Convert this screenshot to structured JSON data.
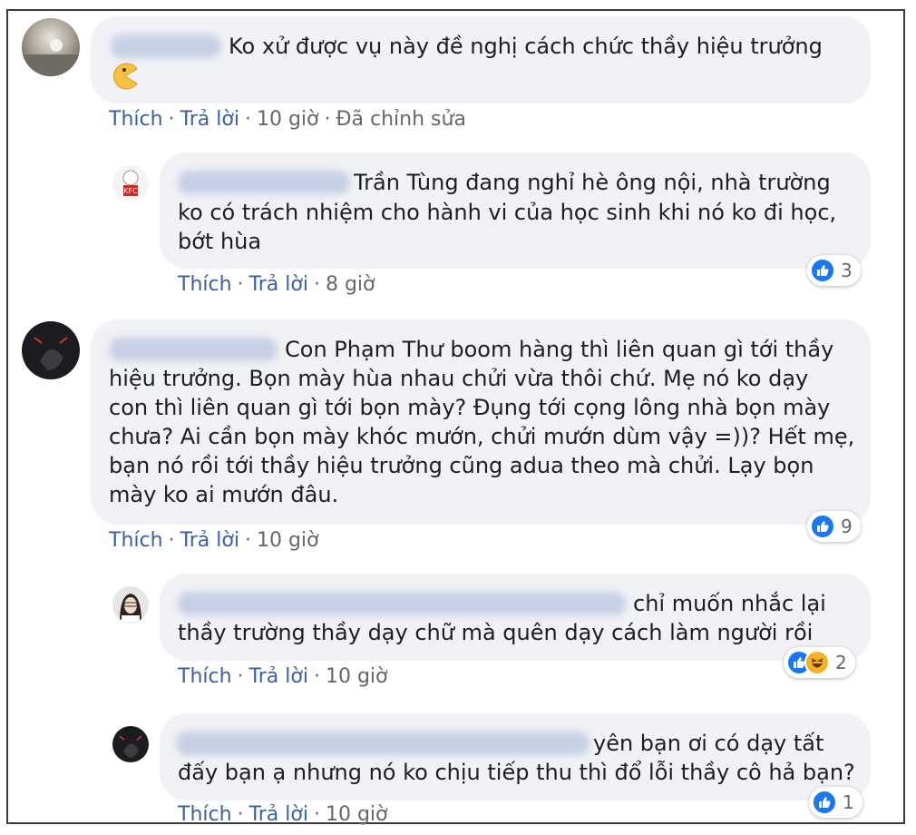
{
  "comments": [
    {
      "author": "",
      "text_lines": [
        "Ko xử được vụ này đề nghị cách chức thầy hiệu trưởng"
      ],
      "actions": {
        "like": "Thích",
        "reply": "Trả lời",
        "time": "10 giờ",
        "edited": "Đã chỉnh sửa"
      }
    },
    {
      "author": "",
      "text_lines": [
        "Trần Tùng đang nghỉ hè ông nội, nhà trường",
        "ko có trách nhiệm cho hành vi của học sinh khi nó ko đi học,",
        "bớt hùa"
      ],
      "actions": {
        "like": "Thích",
        "reply": "Trả lời",
        "time": "8 giờ"
      },
      "reaction_count": "3"
    },
    {
      "author": "",
      "text_lines": [
        "Con Phạm Thư boom hàng thì liên quan gì tới thầy",
        "hiệu trưởng. Bọn mày hùa nhau chửi vừa thôi chứ. Mẹ nó ko dạy",
        "con thì liên quan gì tới bọn mày? Đụng tới cọng lông nhà bọn mày",
        "chưa? Ai cần bọn mày khóc mướn, chửi mướn dùm vậy =))? Hết mẹ,",
        "bạn nó rồi tới thầy hiệu trưởng cũng adua theo mà chửi. Lạy bọn",
        "mày ko ai mướn đâu."
      ],
      "actions": {
        "like": "Thích",
        "reply": "Trả lời",
        "time": "10 giờ"
      },
      "reaction_count": "9"
    },
    {
      "author": "",
      "text_lines": [
        "chỉ muốn nhắc lại",
        "thầy trường thầy dạy chữ mà quên dạy cách làm người rồi"
      ],
      "actions": {
        "like": "Thích",
        "reply": "Trả lời",
        "time": "10 giờ"
      },
      "reaction_count": "2"
    },
    {
      "author": "",
      "text_lines": [
        "yên bạn ơi có dạy tất",
        "đấy bạn ạ nhưng nó ko chịu tiếp thu thì đổ lỗi thầy cô hả bạn?"
      ],
      "actions": {
        "like": "Thích",
        "reply": "Trả lời",
        "time": "10 giờ"
      },
      "reaction_count": "1"
    }
  ],
  "icons": {
    "like": "thumbs-up-icon",
    "haha": "laughing-face-icon",
    "pacman": "pacman-emoji-icon"
  },
  "colors": {
    "bubble": "#f0f2f5",
    "link": "#3a5fa8",
    "like_blue": "#1877f2",
    "haha_yellow": "#f7b125"
  }
}
